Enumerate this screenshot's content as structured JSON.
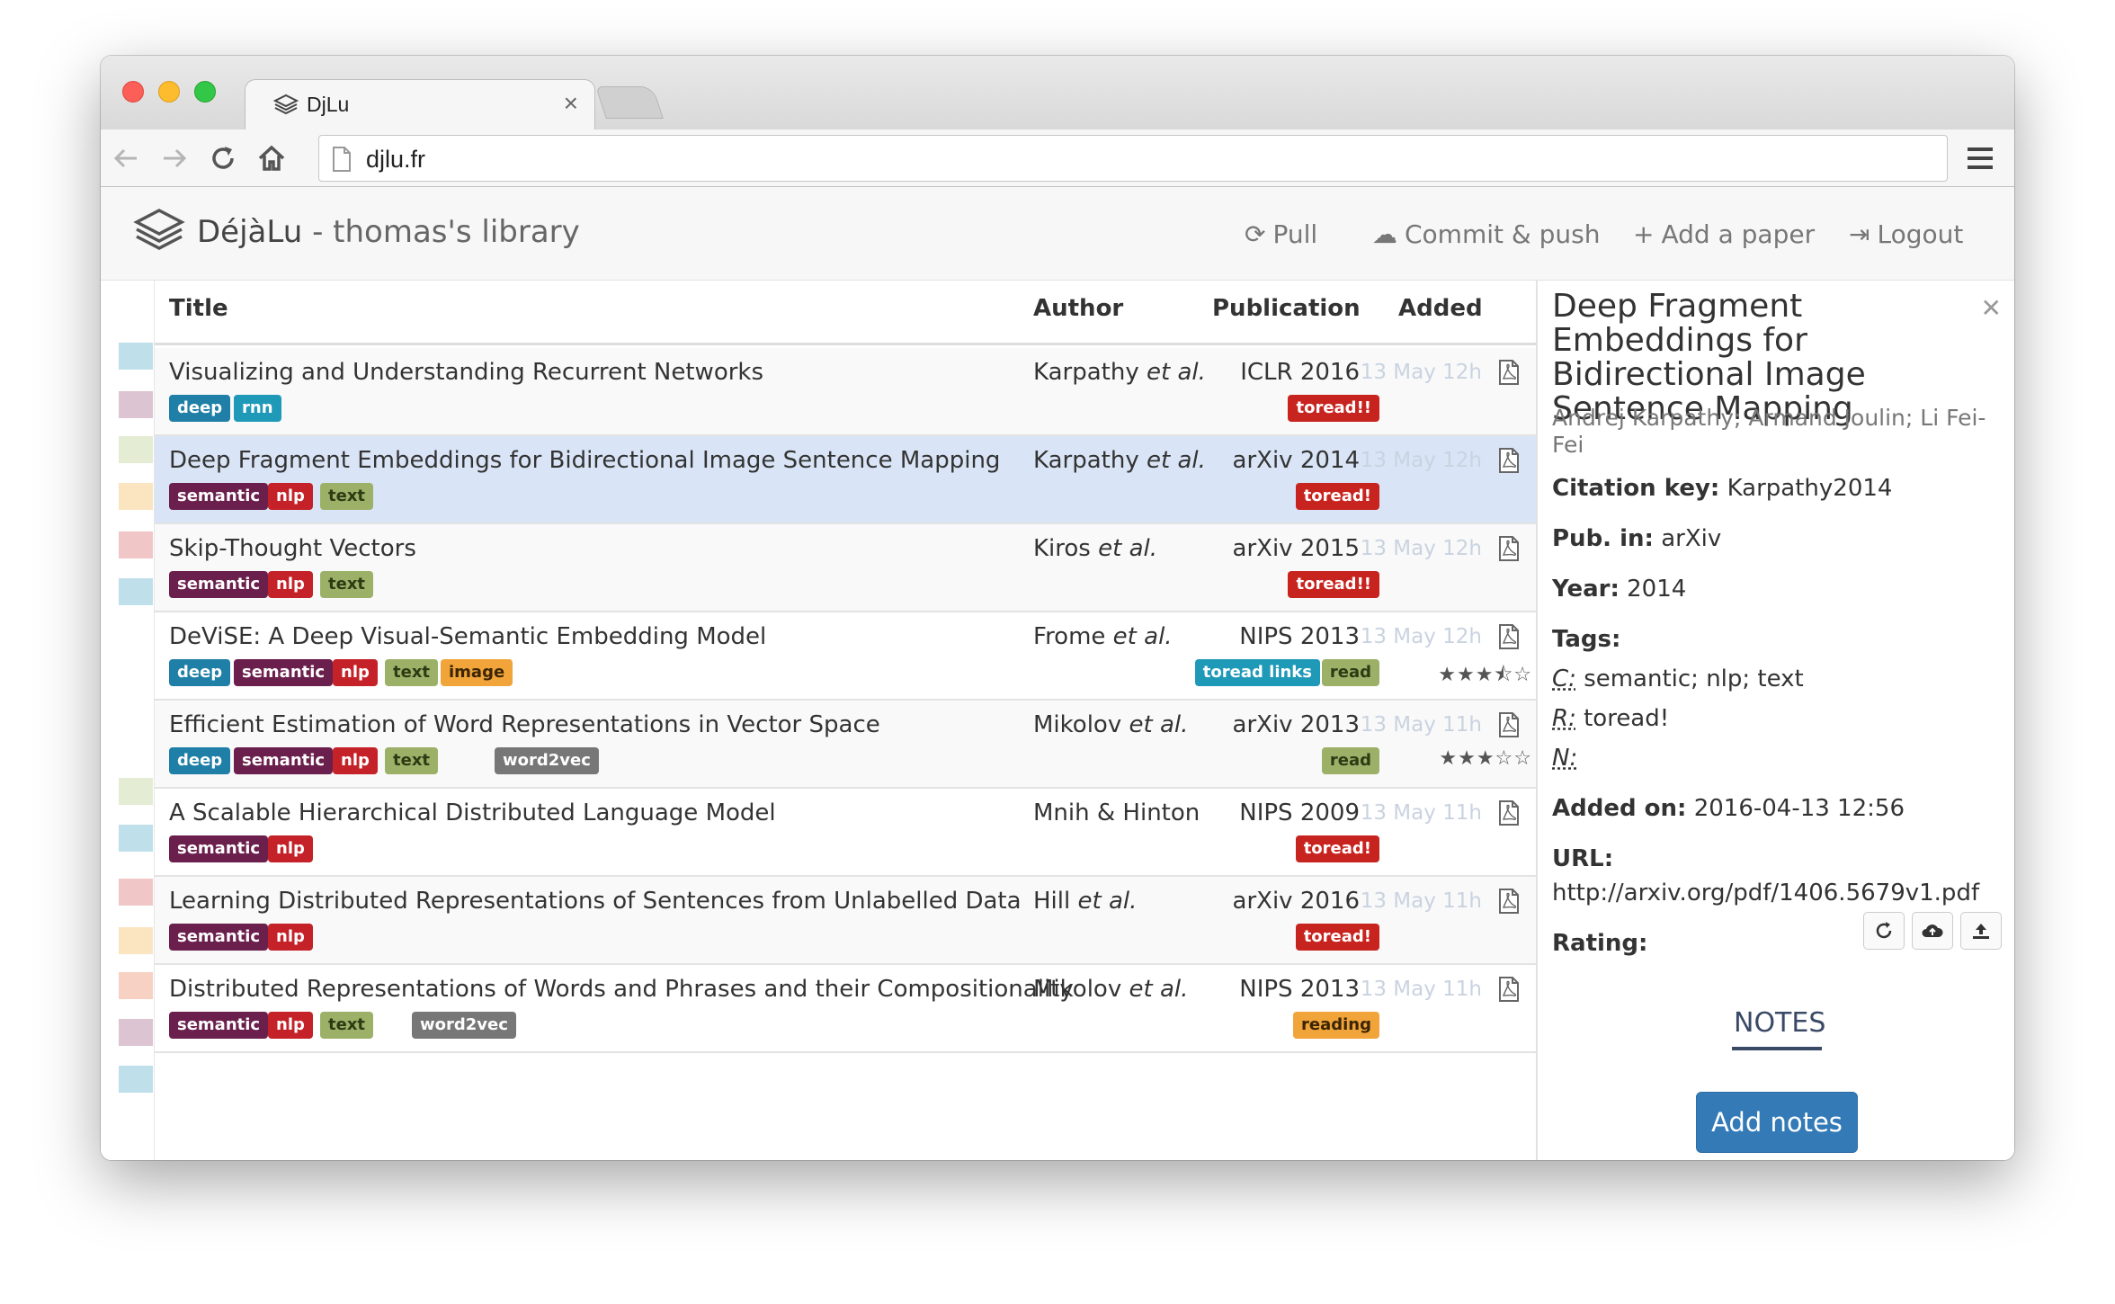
{
  "browser": {
    "tab_title": "DjLu",
    "tab_close": "×",
    "url": "djlu.fr"
  },
  "app": {
    "brand_name": "DéjàLu",
    "brand_suffix": " - thomas's library",
    "nav": {
      "pull": "Pull",
      "commit": "Commit & push",
      "add": "Add a paper",
      "logout": "Logout"
    }
  },
  "table": {
    "headers": {
      "title": "Title",
      "author": "Author",
      "publication": "Publication",
      "added": "Added"
    },
    "rows": [
      {
        "title": "Visualizing and Understanding Recurrent Networks",
        "author": "Karpathy",
        "etal": " et al.",
        "publication": "ICLR 2016",
        "added": "13 May 12h",
        "tags": [
          "deep",
          "rnn"
        ],
        "rtags": [
          "toread!!"
        ],
        "stars": ""
      },
      {
        "title": "Deep Fragment Embeddings for Bidirectional Image Sentence Mapping",
        "author": "Karpathy",
        "etal": " et al.",
        "publication": "arXiv 2014",
        "added": "13 May 12h",
        "tags": [
          "semantic",
          "nlp",
          "text"
        ],
        "rtags": [
          "toread!"
        ],
        "stars": ""
      },
      {
        "title": "Skip-Thought Vectors",
        "author": "Kiros",
        "etal": " et al.",
        "publication": "arXiv 2015",
        "added": "13 May 12h",
        "tags": [
          "semantic",
          "nlp",
          "text"
        ],
        "rtags": [
          "toread!!"
        ],
        "stars": ""
      },
      {
        "title": "DeViSE: A Deep Visual-Semantic Embedding Model",
        "author": "Frome",
        "etal": " et al.",
        "publication": "NIPS 2013",
        "added": "13 May 12h",
        "tags": [
          "deep",
          "semantic",
          "nlp",
          "text",
          "image"
        ],
        "rtags": [
          "toread links",
          "read"
        ],
        "stars": "★★★⯪☆"
      },
      {
        "title": "Efficient Estimation of Word Representations in Vector Space",
        "author": "Mikolov",
        "etal": " et al.",
        "publication": "arXiv 2013",
        "added": "13 May 11h",
        "tags": [
          "deep",
          "semantic",
          "nlp",
          "text",
          "word2vec"
        ],
        "rtags": [
          "read"
        ],
        "stars": "★★★☆☆"
      },
      {
        "title": "A Scalable Hierarchical Distributed Language Model",
        "author": "Mnih & Hinton",
        "etal": "",
        "publication": "NIPS 2009",
        "added": "13 May 11h",
        "tags": [
          "semantic",
          "nlp"
        ],
        "rtags": [
          "toread!"
        ],
        "stars": ""
      },
      {
        "title": "Learning Distributed Representations of Sentences from Unlabelled Data",
        "author": "Hill",
        "etal": " et al.",
        "publication": "arXiv 2016",
        "added": "13 May 11h",
        "tags": [
          "semantic",
          "nlp"
        ],
        "rtags": [
          "toread!"
        ],
        "stars": ""
      },
      {
        "title": "Distributed Representations of Words and Phrases and their Compositionality",
        "author": "Mikolov",
        "etal": " et al.",
        "publication": "NIPS 2013",
        "added": "13 May 11h",
        "tags": [
          "semantic",
          "nlp",
          "text",
          "word2vec"
        ],
        "rtags": [
          "reading"
        ],
        "stars": ""
      }
    ]
  },
  "detail": {
    "title": "Deep Fragment Embeddings for Bidirectional Image Sentence Mapping",
    "authors": "Andrej Karpathy; Armand Joulin; Li Fei-Fei",
    "citation_key_label": "Citation key:",
    "citation_key": "Karpathy2014",
    "pub_in_label": "Pub. in:",
    "pub_in": "arXiv",
    "year_label": "Year:",
    "year": "2014",
    "tags_label": "Tags:",
    "tags_c_label": "C:",
    "tags_c": "semantic; nlp; text",
    "tags_r_label": "R:",
    "tags_r": "toread!",
    "tags_n_label": "N:",
    "added_label": "Added on:",
    "added": "2016-04-13 12:56",
    "url_label": "URL:",
    "url": "http://arxiv.org/pdf/1406.5679v1.pdf",
    "rating_label": "Rating:",
    "notes_tab": "NOTES",
    "add_notes": "Add notes"
  },
  "colors": {
    "selected_row": "#d9e5f6",
    "primary_button": "#337ab7",
    "tag_deep": "#1f7fa6",
    "tag_semantic": "#6b1f4c",
    "tag_nlp": "#c42228",
    "tag_text": "#9cb167",
    "tag_image": "#f0a43a",
    "tag_word2vec": "#777777",
    "tag_toread": "#c8241f"
  }
}
